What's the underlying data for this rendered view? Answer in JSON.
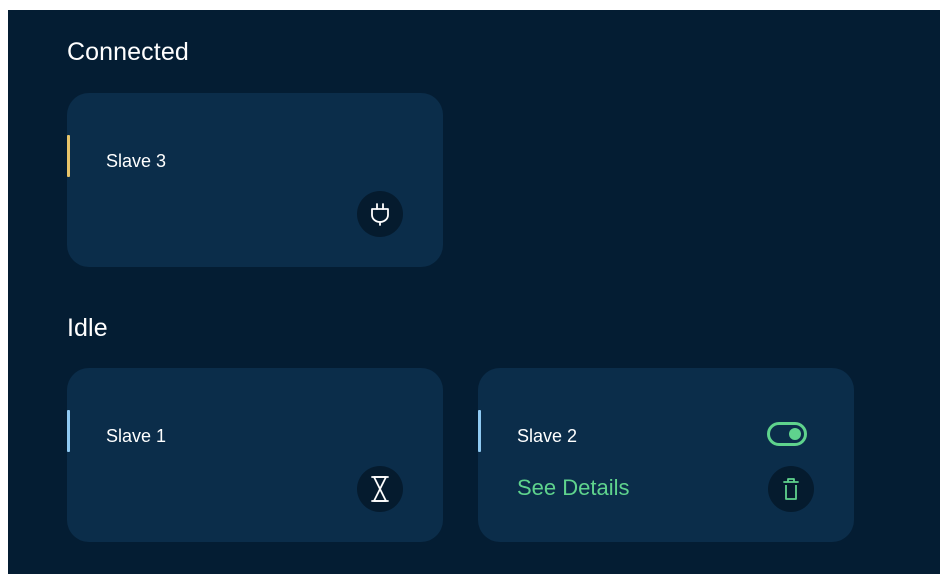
{
  "sections": {
    "connected": {
      "title": "Connected",
      "cards": [
        {
          "label": "Slave 3",
          "accent_color": "#e7c46a",
          "icon": "plug-icon"
        }
      ]
    },
    "idle": {
      "title": "Idle",
      "cards": [
        {
          "label": "Slave 1",
          "accent_color": "#8fc9f2",
          "icon": "hourglass-icon"
        },
        {
          "label": "Slave 2",
          "accent_color": "#8fc9f2",
          "toggle_on": true,
          "link_label": "See Details",
          "icon": "trash-icon"
        }
      ]
    }
  },
  "colors": {
    "background": "#041d33",
    "card": "#0b2d4a",
    "icon_circle": "#051b2e",
    "accent_green": "#5fd38d"
  }
}
